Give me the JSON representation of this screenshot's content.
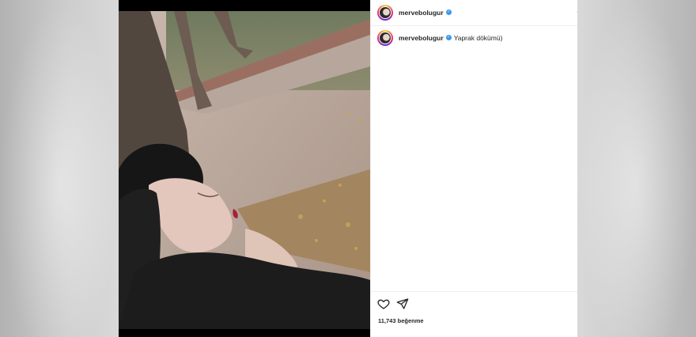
{
  "post": {
    "username": "mervebolugur",
    "caption": "Yaprak dökümü)",
    "likes_text": "11,743 beğenme",
    "more_icon": "ellipsis-icon",
    "icons": {
      "like": "heart-icon",
      "share": "paper-plane-icon",
      "verified": "verified-badge-icon"
    }
  },
  "colors": {
    "verified": "#3897f0",
    "text": "#262626",
    "divider": "#efefef"
  }
}
